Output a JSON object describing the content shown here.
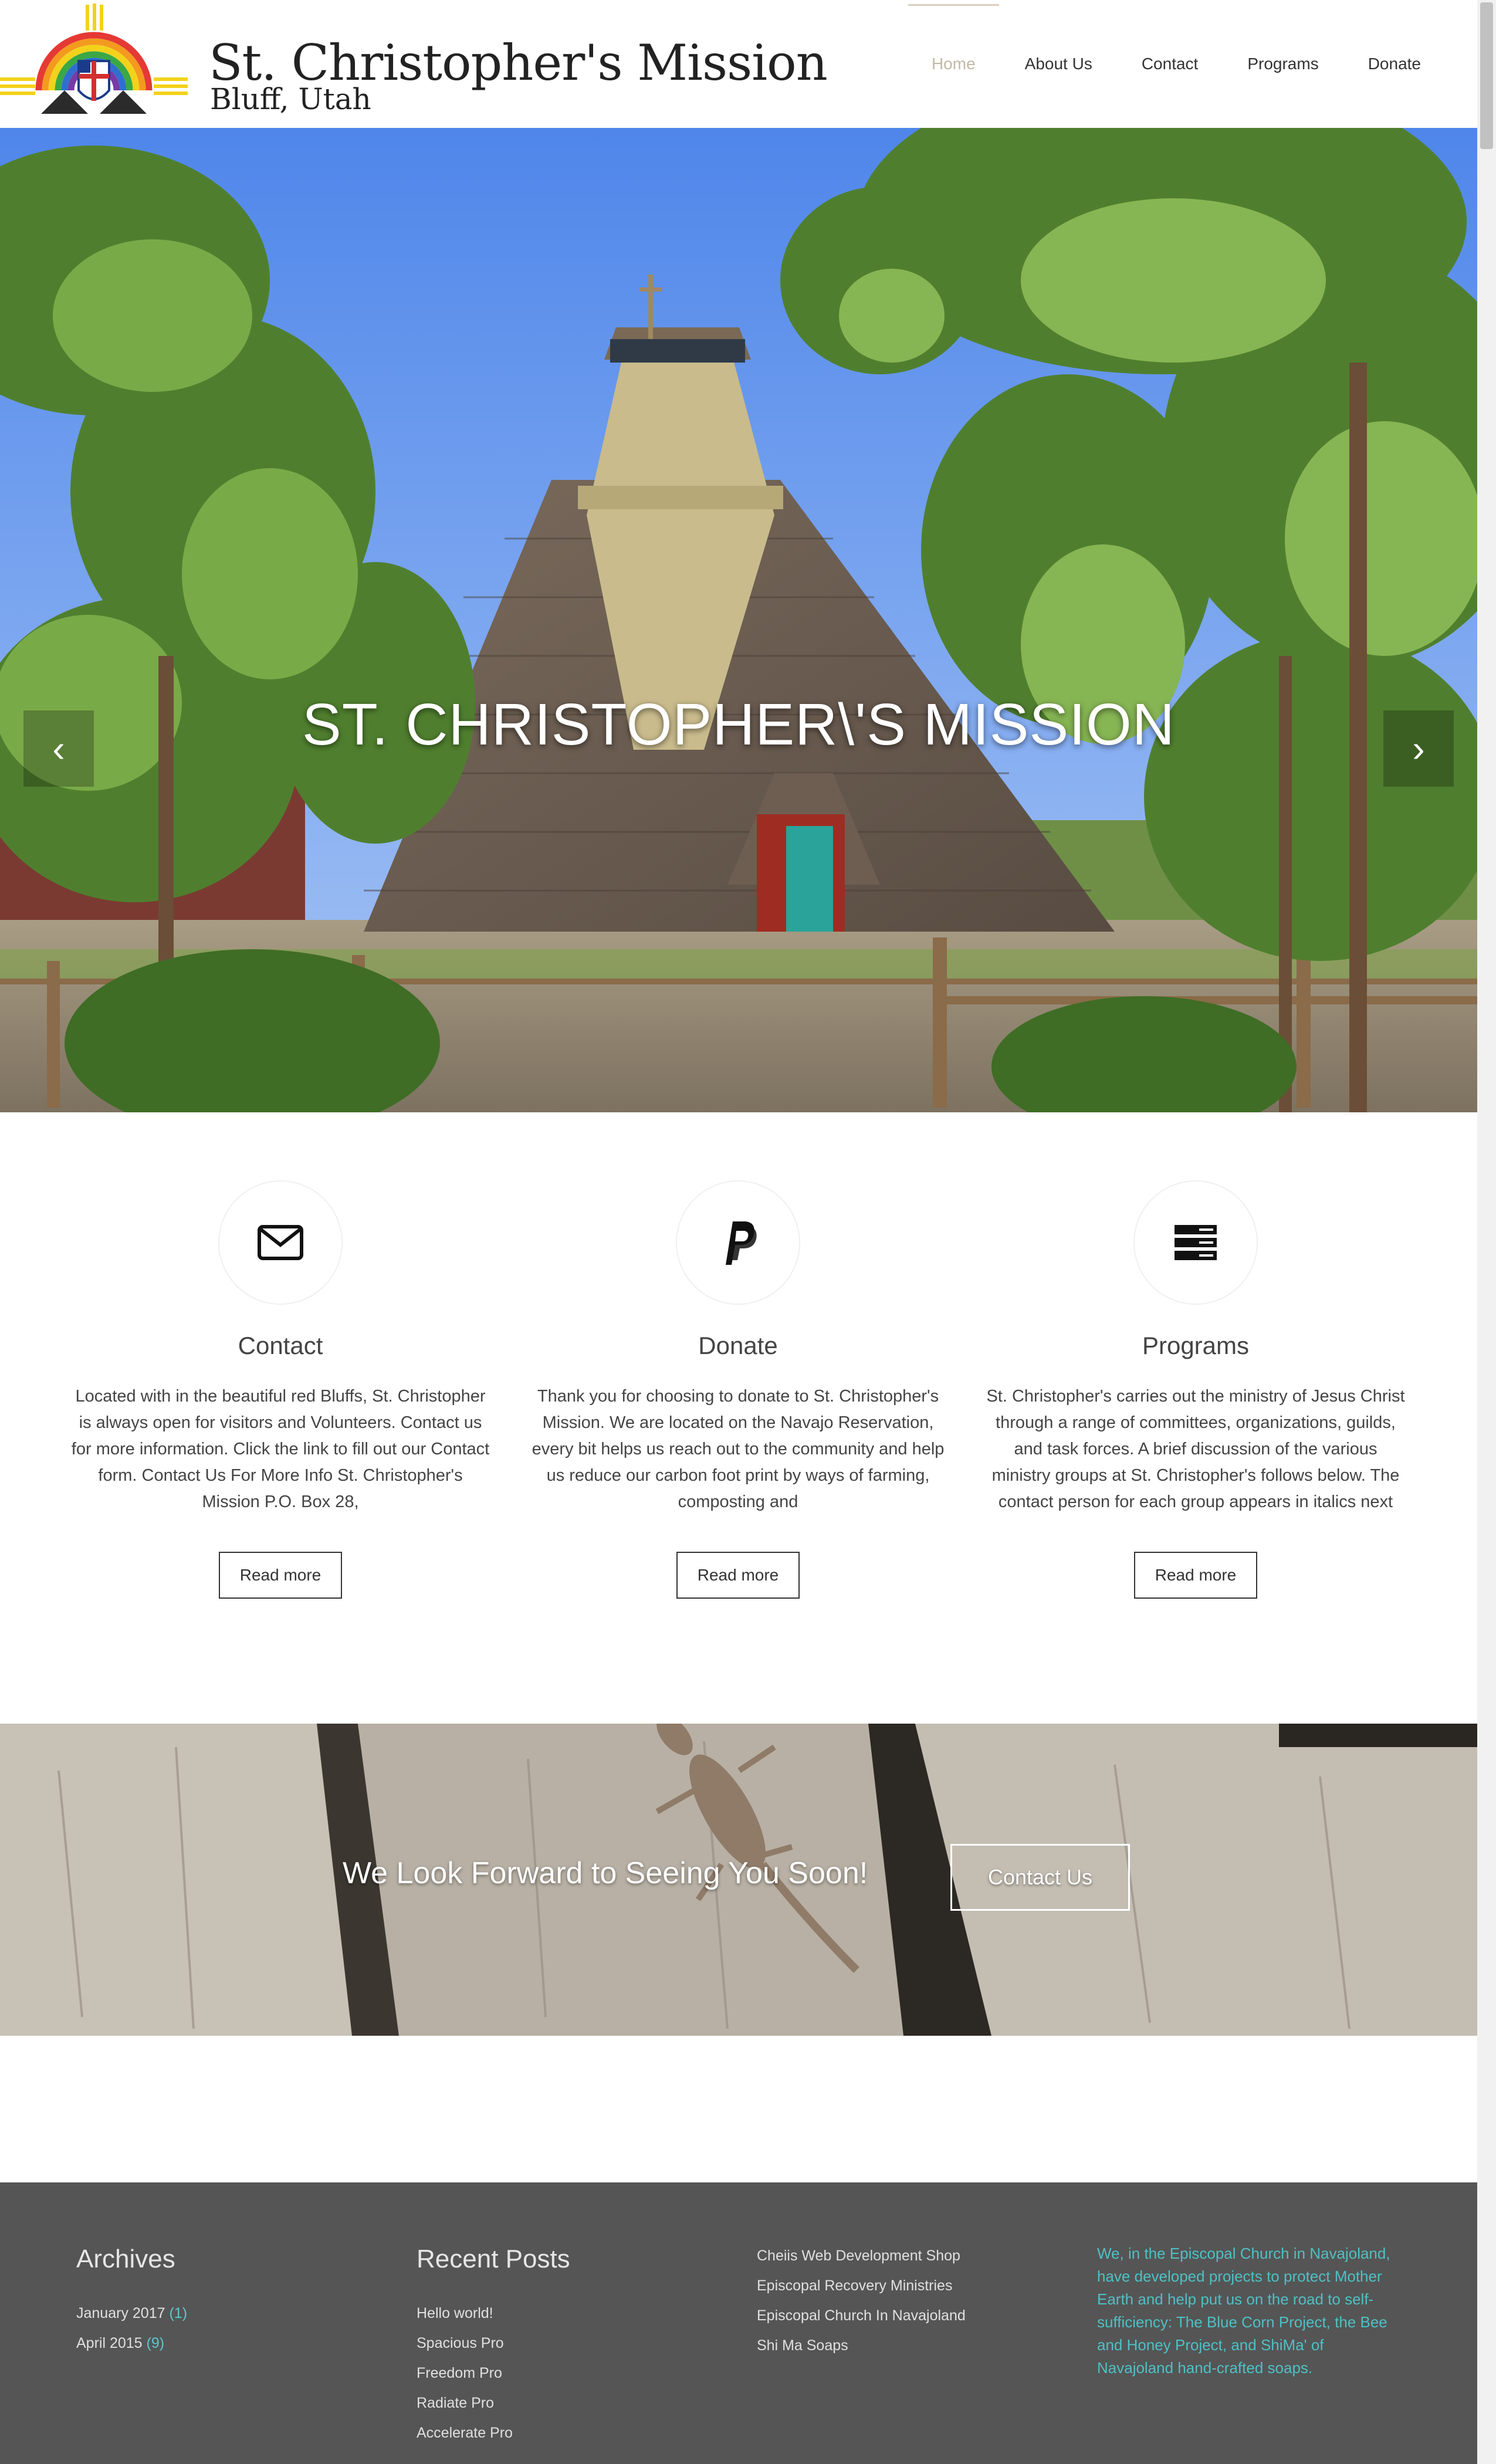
{
  "site": {
    "name": "St. Christopher's Mission",
    "location": "Bluff, Utah"
  },
  "nav": {
    "items": [
      {
        "label": "Home"
      },
      {
        "label": "About Us"
      },
      {
        "label": "Contact"
      },
      {
        "label": "Programs"
      },
      {
        "label": "Donate"
      }
    ],
    "active": "Home"
  },
  "hero": {
    "title": "ST. CHRISTOPHER\\'S MISSION",
    "prev_icon": "chevron-left-icon",
    "next_icon": "chevron-right-icon"
  },
  "features": [
    {
      "icon": "envelope-icon",
      "title": "Contact",
      "text": "Located with in the beautiful red Bluffs, St. Christopher is always open for visitors and Volunteers. Contact us for more information. Click the link to fill out our Contact form. Contact Us For More Info St. Christopher's Mission P.O. Box 28,",
      "button": "Read more"
    },
    {
      "icon": "paypal-icon",
      "title": "Donate",
      "text": "Thank you for choosing to donate to St. Christopher's Mission. We are located on the Navajo Reservation, every bit helps us reach out to the community and help us reduce our carbon foot print by ways of farming, composting and",
      "button": "Read more"
    },
    {
      "icon": "server-stack-icon",
      "title": "Programs",
      "text": "St. Christopher's carries out the ministry of Jesus Christ through a range of committees, organizations, guilds, and task forces.  A brief discussion of the various ministry groups at St. Christopher's follows below.  The contact person for each group appears in italics next",
      "button": "Read more"
    }
  ],
  "cta": {
    "text": "We Look Forward to Seeing You Soon!",
    "button": "Contact Us"
  },
  "footer": {
    "archives": {
      "heading": "Archives",
      "items": [
        {
          "label": "January 2017",
          "count": "(1)"
        },
        {
          "label": "April 2015",
          "count": "(9)"
        }
      ]
    },
    "recent_posts": {
      "heading": "Recent Posts",
      "items": [
        "Hello world!",
        "Spacious Pro",
        "Freedom Pro",
        "Radiate Pro",
        "Accelerate Pro"
      ]
    },
    "links": {
      "items": [
        "Cheiis Web Development Shop",
        "Episcopal Recovery Ministries",
        "Episcopal Church In Navajoland",
        "Shi Ma Soaps"
      ]
    },
    "about_text": "We, in the Episcopal Church in Navajoland, have developed projects to protect Mother Earth and help put us on the road to self-sufficiency: The Blue Corn Project, the Bee and Honey Project, and ShiMa' of Navajoland hand-crafted soaps."
  },
  "colors": {
    "nav_active": "#c2b9a6",
    "footer_bg": "#555555",
    "footer_accent": "#4fc0c4",
    "sky": "#7aa6f2",
    "roof": "#6e6154"
  }
}
